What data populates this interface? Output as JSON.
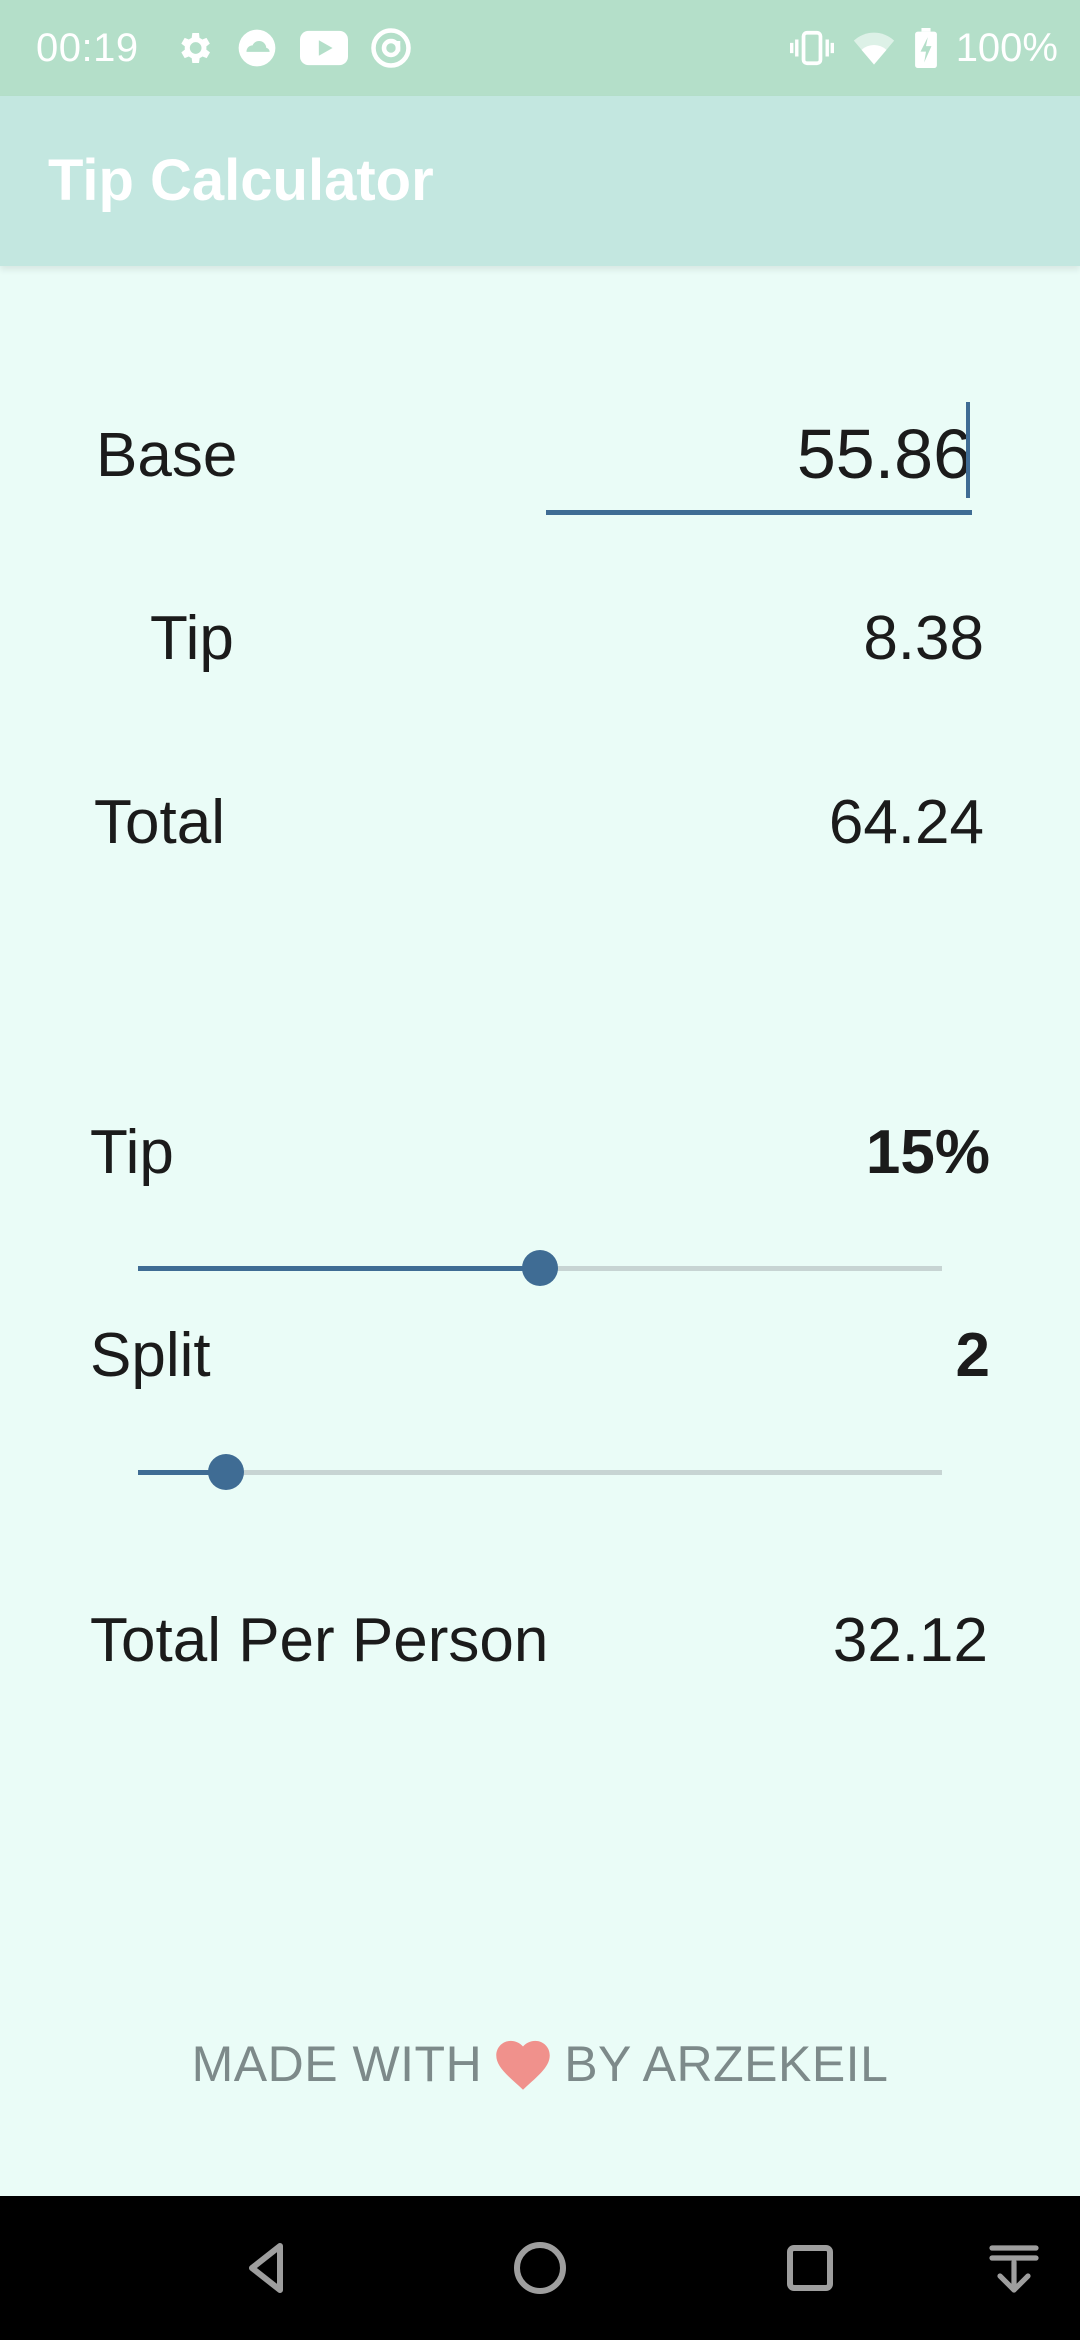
{
  "status_bar": {
    "time": "00:19",
    "left_icons": [
      "gear-icon",
      "cloud-sync-icon",
      "youtube-icon",
      "at-sign-icon"
    ],
    "right_icons": [
      "vibrate-icon",
      "wifi-icon",
      "battery-charging-icon"
    ],
    "battery": "100%"
  },
  "app_bar": {
    "title": "Tip Calculator"
  },
  "calculator": {
    "base_label": "Base",
    "base_value": "55.86",
    "tip_label": "Tip",
    "tip_value": "8.38",
    "total_label": "Total",
    "total_value": "64.24"
  },
  "controls": {
    "tip_label": "Tip",
    "tip_percent": "15%",
    "tip_slider_fraction": 0.5,
    "split_label": "Split",
    "split_value": "2",
    "split_slider_fraction": 0.11,
    "per_person_label": "Total Per Person",
    "per_person_value": "32.12"
  },
  "footer": {
    "prefix": "MADE WITH",
    "suffix": "BY ARZEKEIL",
    "icon": "heart-icon",
    "heart_color": "#f0918c"
  },
  "nav_bar": {
    "buttons": [
      "back-icon",
      "home-icon",
      "recents-icon",
      "notification-drawer-icon"
    ]
  },
  "colors": {
    "accent": "#3f6c94",
    "status_bar": "#b4dfc9",
    "app_bar": "#c3e7e0",
    "background": "#eafcf7"
  }
}
